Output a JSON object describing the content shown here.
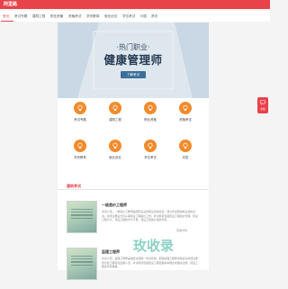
{
  "header": {
    "logo": "阿里路"
  },
  "nav": {
    "items": [
      {
        "label": "首页",
        "active": true
      },
      {
        "label": "考试专题"
      },
      {
        "label": "建筑工程"
      },
      {
        "label": "职业资格"
      },
      {
        "label": "资格考试"
      },
      {
        "label": "学历教育"
      },
      {
        "label": "就业创业"
      },
      {
        "label": "学位考试"
      },
      {
        "label": "问答"
      },
      {
        "label": "资讯"
      }
    ]
  },
  "banner": {
    "subtitle": "·热门职业·",
    "title": "健康管理师",
    "button": "了解考试"
  },
  "categories": [
    {
      "label": "考试专题",
      "icon": "lightbulb-icon"
    },
    {
      "label": "建筑工程",
      "icon": "lightbulb-icon"
    },
    {
      "label": "职业资格",
      "icon": "lightbulb-icon"
    },
    {
      "label": "资格考试",
      "icon": "lightbulb-icon"
    },
    {
      "label": "学历教育",
      "icon": "lightbulb-icon"
    },
    {
      "label": "就业创业",
      "icon": "lightbulb-icon"
    },
    {
      "label": "学位考试",
      "icon": "lightbulb-icon"
    },
    {
      "label": "问答",
      "icon": "lightbulb-icon"
    }
  ],
  "section": {
    "title": "建筑考试",
    "cards": [
      {
        "title": "一级造价工程师",
        "desc": "考试介绍：一级造价工程师是国家设立的职业资格考试，通过考试取得执业资格证书，并经注册后方可从事建设工程造价工作。考试科目包括建设工程造价管理、建设工程计价、建设工程技术与计量、建设工程造价案例分析。",
        "more": "查看详情"
      },
      {
        "title": "监理工程师",
        "desc": "考试介绍：监理工程师是指经全国统一考试合格，取得监理工程师资格证书并经注册登记的工程建设监理人员。考试科目包括建设工程监理基本理论和相关法规、建设工程合同管理等。",
        "more": "查看详情"
      }
    ]
  },
  "float": {
    "label": "在线"
  },
  "watermark": "玫收录",
  "colors": {
    "brand": "#e8424a",
    "icon_orange": "#f28b2c"
  }
}
